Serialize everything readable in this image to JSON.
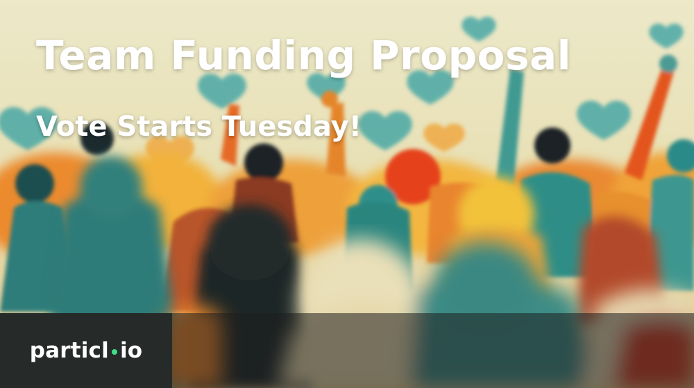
{
  "banner": {
    "title": "Team Funding Proposal",
    "subtitle": "Vote Starts Tuesday!",
    "illustration": "crowd of people with raised hands and floating hearts"
  },
  "logo": {
    "part1": "particl",
    "part2": "io",
    "dot_color": "#3fdf8a"
  },
  "colors": {
    "background": "#e9e4c4",
    "teal": "#3a8c86",
    "orange": "#e9842c",
    "red": "#e4421f",
    "yellow": "#f2c23a",
    "footer_dark": "#262a29"
  }
}
